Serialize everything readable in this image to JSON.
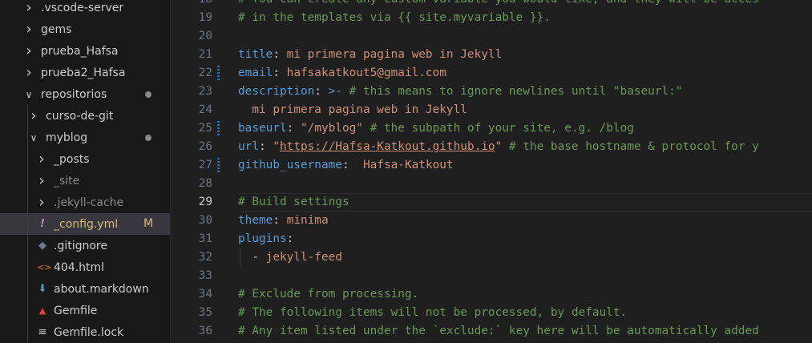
{
  "explorer": {
    "items": [
      {
        "label": ".vscode-server",
        "type": "folder",
        "expanded": false,
        "level": 0
      },
      {
        "label": "gems",
        "type": "folder",
        "expanded": false,
        "level": 0
      },
      {
        "label": "prueba_Hafsa",
        "type": "folder",
        "expanded": false,
        "level": 0
      },
      {
        "label": "prueba2_Hafsa",
        "type": "folder",
        "expanded": false,
        "level": 0
      },
      {
        "label": "repositorios",
        "type": "folder",
        "expanded": true,
        "level": 0,
        "badge": "dot"
      },
      {
        "label": "curso-de-git",
        "type": "folder",
        "expanded": false,
        "level": 1
      },
      {
        "label": "myblog",
        "type": "folder",
        "expanded": true,
        "level": 1,
        "badge": "dot"
      },
      {
        "label": "_posts",
        "type": "folder",
        "expanded": false,
        "level": 2
      },
      {
        "label": "_site",
        "type": "folder",
        "expanded": false,
        "level": 2,
        "dim": true
      },
      {
        "label": ".jekyll-cache",
        "type": "folder",
        "expanded": false,
        "level": 2,
        "dim": true
      },
      {
        "label": "_config.yml",
        "type": "file",
        "icon": "yaml-exclamation-icon",
        "icon_color": "#c586c0",
        "level": 2,
        "selected": true,
        "badge": "M"
      },
      {
        "label": ".gitignore",
        "type": "file",
        "icon": "git-diamond-icon",
        "icon_color": "#6b7a8a",
        "level": 2
      },
      {
        "label": "404.html",
        "type": "file",
        "icon": "html-tag-icon",
        "icon_color": "#e37933",
        "level": 2
      },
      {
        "label": "about.markdown",
        "type": "file",
        "icon": "markdown-arrow-icon",
        "icon_color": "#519aba",
        "level": 2
      },
      {
        "label": "Gemfile",
        "type": "file",
        "icon": "ruby-gem-icon",
        "icon_color": "#e0413a",
        "level": 2
      },
      {
        "label": "Gemfile.lock",
        "type": "file",
        "icon": "lines-icon",
        "icon_color": "#cccccc",
        "level": 2
      }
    ]
  },
  "editor": {
    "active_line": "29",
    "lines": [
      {
        "n": "18",
        "tokens": [
          {
            "t": "# You can create any custom variable you would like, and they will be acces",
            "c": "c"
          }
        ]
      },
      {
        "n": "19",
        "tokens": [
          {
            "t": "# in the templates via {{ site.myvariable }}.",
            "c": "c"
          }
        ]
      },
      {
        "n": "20",
        "tokens": []
      },
      {
        "n": "21",
        "tokens": [
          {
            "t": "title",
            "c": "k"
          },
          {
            "t": ": ",
            "c": "o"
          },
          {
            "t": "mi primera pagina web in Jekyll",
            "c": "s"
          }
        ]
      },
      {
        "n": "22",
        "mod": true,
        "tokens": [
          {
            "t": "email",
            "c": "k"
          },
          {
            "t": ": ",
            "c": "o"
          },
          {
            "t": "hafsakatkout5@gmail.com",
            "c": "s"
          }
        ]
      },
      {
        "n": "23",
        "tokens": [
          {
            "t": "description",
            "c": "k"
          },
          {
            "t": ": ",
            "c": "o"
          },
          {
            "t": ">-",
            "c": "k"
          },
          {
            "t": " # this means to ignore newlines until \"baseurl:\"",
            "c": "c"
          }
        ]
      },
      {
        "n": "24",
        "tokens": [
          {
            "t": "  mi primera pagina web in Jekyll",
            "c": "s"
          }
        ]
      },
      {
        "n": "25",
        "mod": true,
        "tokens": [
          {
            "t": "baseurl",
            "c": "k"
          },
          {
            "t": ": ",
            "c": "o"
          },
          {
            "t": "\"/myblog\"",
            "c": "s"
          },
          {
            "t": " # the subpath of your site, e.g. /blog",
            "c": "c"
          }
        ]
      },
      {
        "n": "26",
        "tokens": [
          {
            "t": "url",
            "c": "k"
          },
          {
            "t": ": ",
            "c": "o"
          },
          {
            "t": "\"",
            "c": "s"
          },
          {
            "t": "https://Hafsa-Katkout.github.io",
            "c": "s link"
          },
          {
            "t": "\"",
            "c": "s"
          },
          {
            "t": " # the base hostname & protocol for y",
            "c": "c"
          }
        ]
      },
      {
        "n": "27",
        "mod": true,
        "tokens": [
          {
            "t": "github_username",
            "c": "k"
          },
          {
            "t": ":  ",
            "c": "o"
          },
          {
            "t": "Hafsa-Katkout",
            "c": "s"
          }
        ]
      },
      {
        "n": "28",
        "tokens": []
      },
      {
        "n": "29",
        "tokens": [
          {
            "t": "# Build settings",
            "c": "c"
          }
        ]
      },
      {
        "n": "30",
        "tokens": [
          {
            "t": "theme",
            "c": "k"
          },
          {
            "t": ": ",
            "c": "o"
          },
          {
            "t": "minima",
            "c": "s"
          }
        ]
      },
      {
        "n": "31",
        "tokens": [
          {
            "t": "plugins",
            "c": "k"
          },
          {
            "t": ":",
            "c": "o"
          }
        ]
      },
      {
        "n": "32",
        "tokens": [
          {
            "t": "  - ",
            "c": "o"
          },
          {
            "t": "jekyll-feed",
            "c": "s"
          }
        ]
      },
      {
        "n": "33",
        "tokens": []
      },
      {
        "n": "34",
        "tokens": [
          {
            "t": "# Exclude from processing.",
            "c": "c"
          }
        ]
      },
      {
        "n": "35",
        "tokens": [
          {
            "t": "# The following items will not be processed, by default.",
            "c": "c"
          }
        ]
      },
      {
        "n": "36",
        "tokens": [
          {
            "t": "# Any item listed under the `exclude:` key here will be automatically added",
            "c": "c"
          }
        ]
      }
    ]
  }
}
